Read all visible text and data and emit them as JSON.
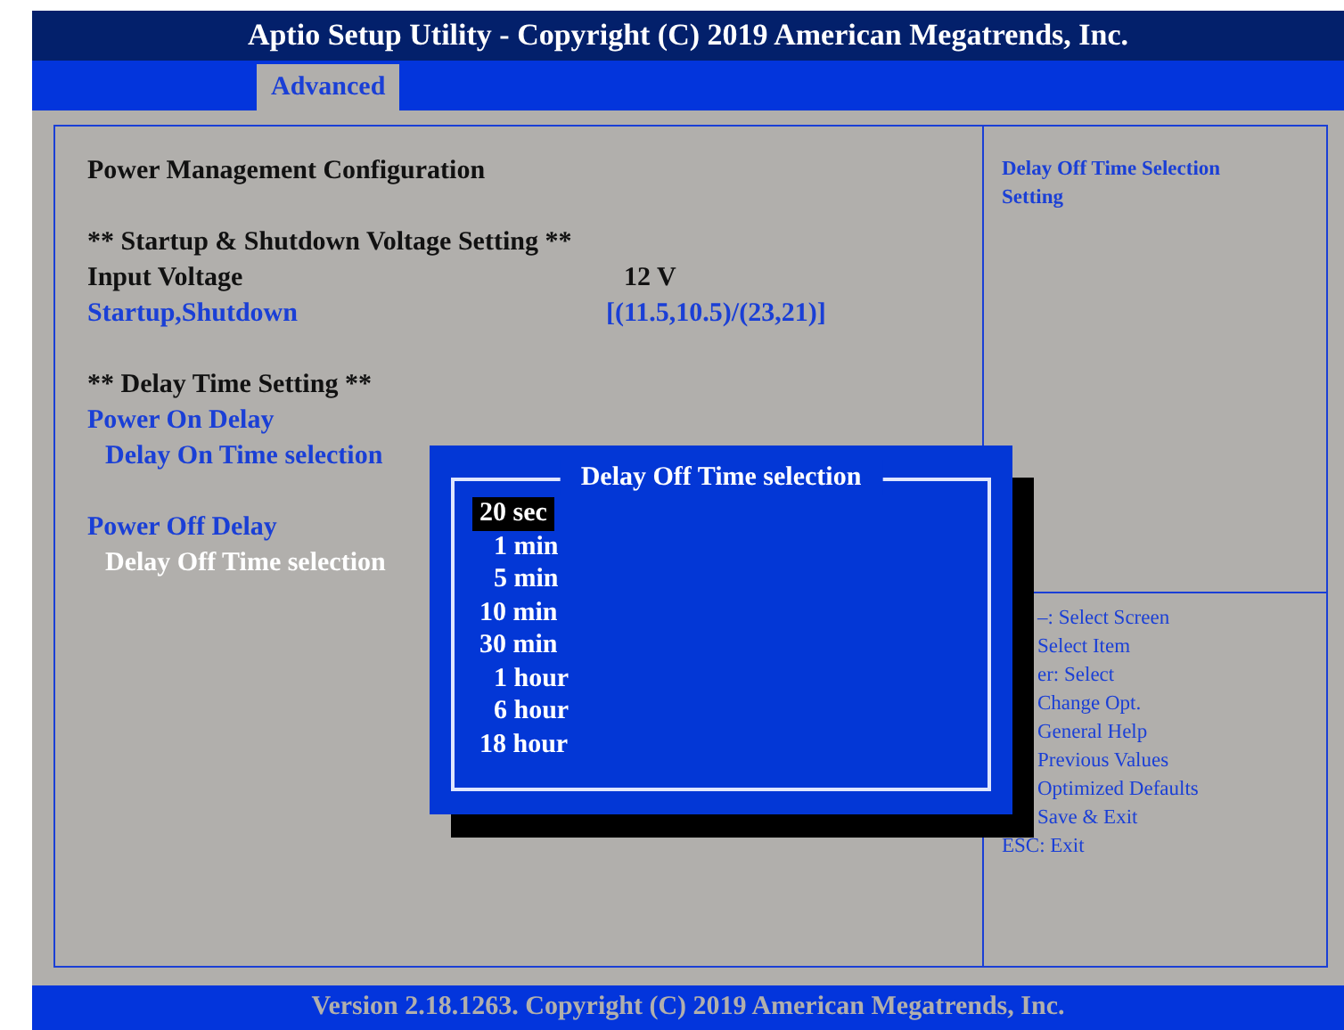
{
  "window": {
    "title": "Aptio Setup Utility - Copyright (C) 2019 American Megatrends, Inc."
  },
  "tabs": [
    {
      "label": "Advanced",
      "selected": true
    }
  ],
  "sections": [
    {
      "items": [
        {
          "kind": "heading",
          "label": "Power Management Configuration"
        }
      ]
    },
    {
      "items": [
        {
          "kind": "heading",
          "label": "** Startup & Shutdown Voltage Setting **"
        },
        {
          "kind": "info",
          "label": "Input Voltage",
          "value": "12 V"
        },
        {
          "kind": "option",
          "label": "Startup,Shutdown",
          "value": "[(11.5,10.5)/(23,21)]",
          "selected": false
        }
      ]
    },
    {
      "items": [
        {
          "kind": "heading",
          "label": "** Delay Time Setting **"
        },
        {
          "kind": "option",
          "label": "Power On Delay",
          "selected": false
        },
        {
          "kind": "suboption",
          "label": "Delay On Time selection",
          "selected": false
        }
      ]
    },
    {
      "items": [
        {
          "kind": "option",
          "label": "Power Off Delay",
          "selected": false
        },
        {
          "kind": "suboption",
          "label": "Delay Off Time selection",
          "selected": true
        }
      ]
    }
  ],
  "help": {
    "text": "Delay Off Time Selection Setting"
  },
  "key_hints": [
    {
      "label": "–: Select Screen",
      "partly_hidden": true
    },
    {
      "label": "Select Item",
      "partly_hidden": true
    },
    {
      "label": "er: Select",
      "partly_hidden": true
    },
    {
      "label": "Change Opt.",
      "partly_hidden": true
    },
    {
      "label": "General Help",
      "partly_hidden": true
    },
    {
      "label": "Previous Values",
      "partly_hidden": true
    },
    {
      "label": "Optimized Defaults",
      "partly_hidden": true
    },
    {
      "label": "Save & Exit",
      "partly_hidden": true
    },
    {
      "label": "ESC: Exit",
      "partly_hidden": false
    }
  ],
  "popup": {
    "title": "Delay Off Time selection",
    "options": [
      {
        "label": "20 sec",
        "selected": true,
        "indent": false
      },
      {
        "label": "1 min",
        "selected": false,
        "indent": true
      },
      {
        "label": "5 min",
        "selected": false,
        "indent": true
      },
      {
        "label": "10 min",
        "selected": false,
        "indent": false
      },
      {
        "label": "30 min",
        "selected": false,
        "indent": false
      },
      {
        "label": "1 hour",
        "selected": false,
        "indent": true
      },
      {
        "label": "6 hour",
        "selected": false,
        "indent": true
      },
      {
        "label": "18 hour",
        "selected": false,
        "indent": false
      }
    ]
  },
  "status_bar": {
    "text": "Version 2.18.1263. Copyright (C) 2019 American Megatrends, Inc."
  }
}
